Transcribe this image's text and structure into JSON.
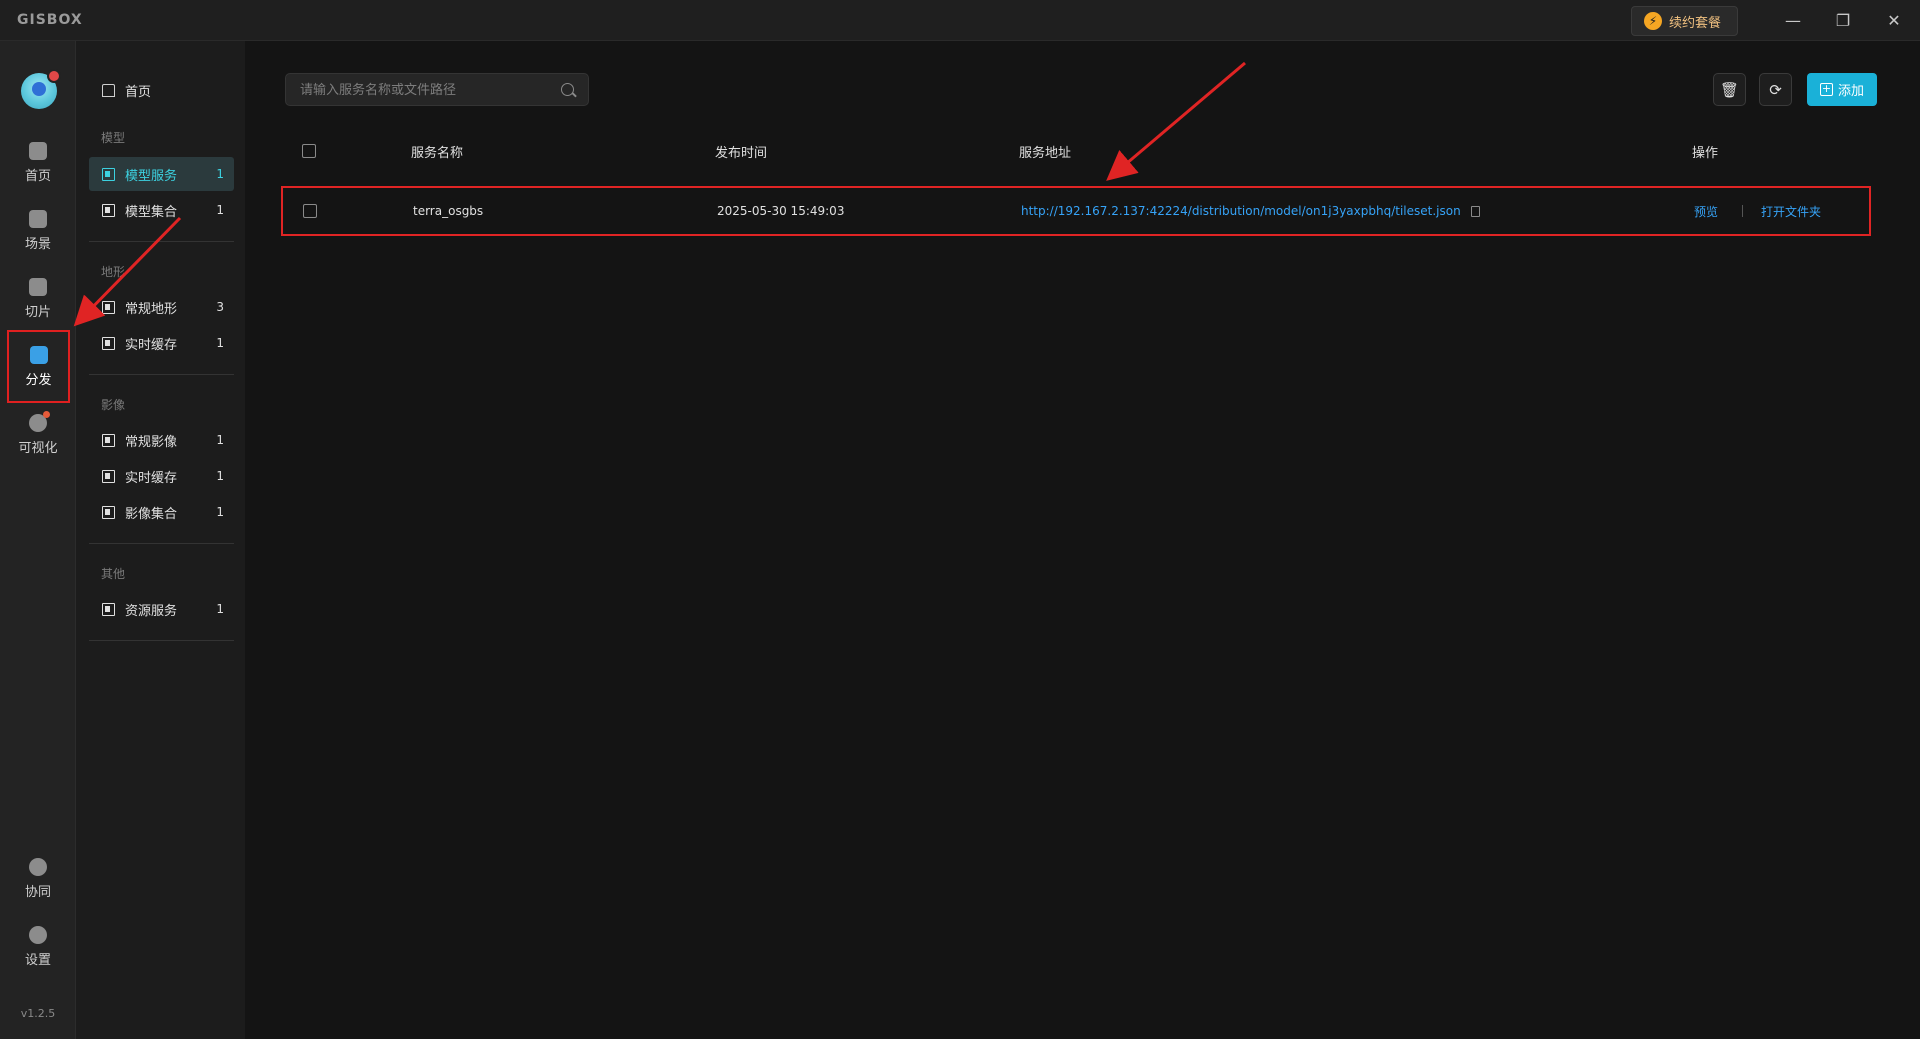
{
  "titlebar": {
    "logo": "GISBOX",
    "renew_label": "续约套餐",
    "minimize": "—",
    "maximize": "❐",
    "close": "✕"
  },
  "rail": {
    "items": [
      {
        "label": "首页",
        "icon": "home-icon"
      },
      {
        "label": "场景",
        "icon": "scene-icon"
      },
      {
        "label": "切片",
        "icon": "slice-icon"
      },
      {
        "label": "分发",
        "icon": "distribute-icon",
        "active": true
      },
      {
        "label": "可视化",
        "icon": "visualize-icon"
      }
    ],
    "bottom_items": [
      {
        "label": "协同",
        "icon": "collab-icon"
      },
      {
        "label": "设置",
        "icon": "settings-icon"
      }
    ],
    "version": "v1.2.5"
  },
  "sidebar": {
    "home_label": "首页",
    "groups": [
      {
        "label": "模型",
        "items": [
          {
            "label": "模型服务",
            "count": "1",
            "active": true
          },
          {
            "label": "模型集合",
            "count": "1"
          }
        ]
      },
      {
        "label": "地形",
        "items": [
          {
            "label": "常规地形",
            "count": "3"
          },
          {
            "label": "实时缓存",
            "count": "1"
          }
        ]
      },
      {
        "label": "影像",
        "items": [
          {
            "label": "常规影像",
            "count": "1"
          },
          {
            "label": "实时缓存",
            "count": "1"
          },
          {
            "label": "影像集合",
            "count": "1"
          }
        ]
      },
      {
        "label": "其他",
        "items": [
          {
            "label": "资源服务",
            "count": "1"
          }
        ]
      }
    ]
  },
  "main": {
    "search_placeholder": "请输入服务名称或文件路径",
    "add_label": "添加",
    "columns": {
      "name": "服务名称",
      "time": "发布时间",
      "url": "服务地址",
      "ops": "操作"
    },
    "rows": [
      {
        "name": "terra_osgbs",
        "time": "2025-05-30 15:49:03",
        "url": "http://192.167.2.137:42224/distribution/model/on1j3yaxpbhq/tileset.json",
        "op_preview": "预览",
        "op_open": "打开文件夹"
      }
    ]
  },
  "colors": {
    "accent": "#1ab1d8",
    "link": "#36a3f7",
    "annotation": "#e02424"
  }
}
